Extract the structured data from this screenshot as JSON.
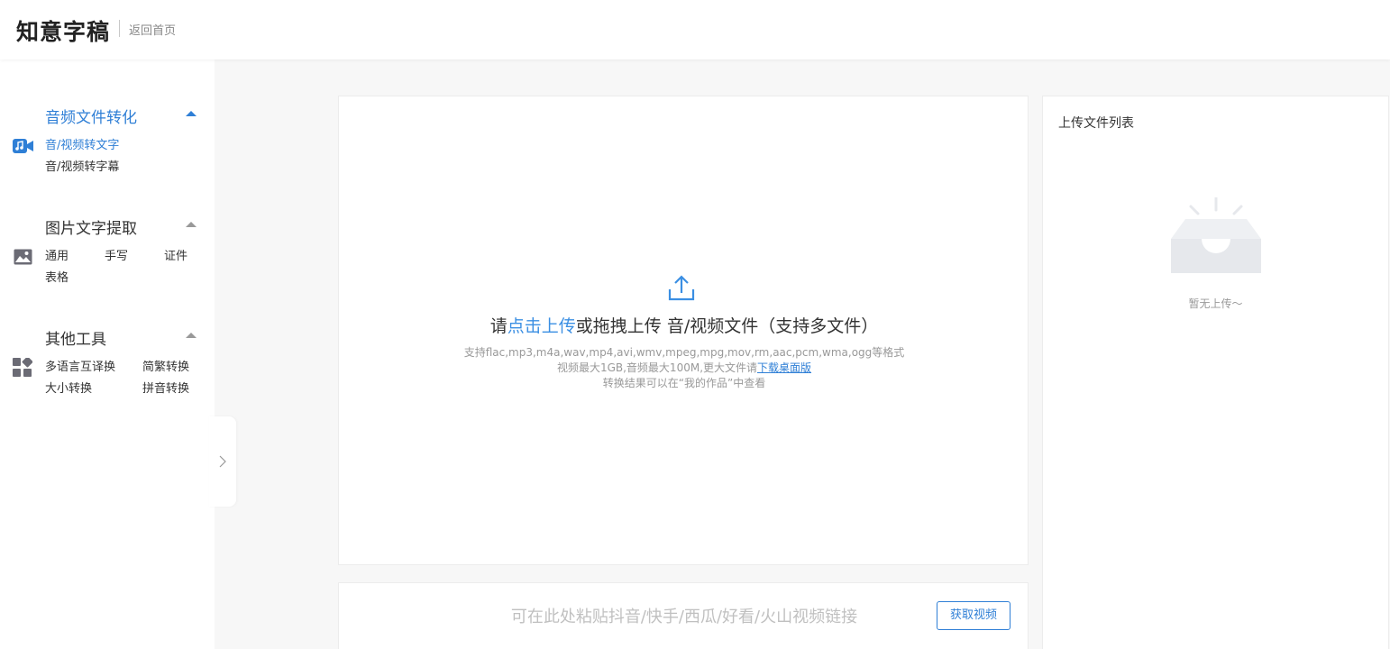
{
  "header": {
    "brand": "知意字稿",
    "back_home": "返回首页"
  },
  "sidebar": {
    "sections": [
      {
        "title": "音频文件转化",
        "icon": "video-audio-icon",
        "active": true,
        "items": [
          "音/视频转文字",
          "音/视频转字幕"
        ]
      },
      {
        "title": "图片文字提取",
        "icon": "image-icon",
        "active": false,
        "items": [
          "通用",
          "手写",
          "证件",
          "表格"
        ]
      },
      {
        "title": "其他工具",
        "icon": "apps-grid-icon",
        "active": false,
        "items": [
          "多语言互译换",
          "简繁转换",
          "大小转换",
          "拼音转换"
        ]
      }
    ],
    "collapse_icon": "chevron-right-icon"
  },
  "upload": {
    "title_prefix": "请",
    "title_link": "点击上传",
    "title_suffix": "或拖拽上传 音/视频文件（支持多文件）",
    "formats": "支持flac,mp3,m4a,wav,mp4,avi,wmv,mpeg,mpg,mov,rm,aac,pcm,wma,ogg等格式",
    "size_prefix": "视频最大1GB,音频最大100M,更大文件请",
    "size_link": "下载桌面版",
    "result_note": "转换结果可以在“我的作品”中查看"
  },
  "link_bar": {
    "placeholder": "可在此处粘贴抖音/快手/西瓜/好看/火山视频链接",
    "value": "",
    "button": "获取视频"
  },
  "upload_list": {
    "title": "上传文件列表",
    "empty_text": "暂无上传～"
  },
  "colors": {
    "accent": "#2f7fd6",
    "link": "#3b8fe3",
    "background": "#f7f7f7"
  }
}
